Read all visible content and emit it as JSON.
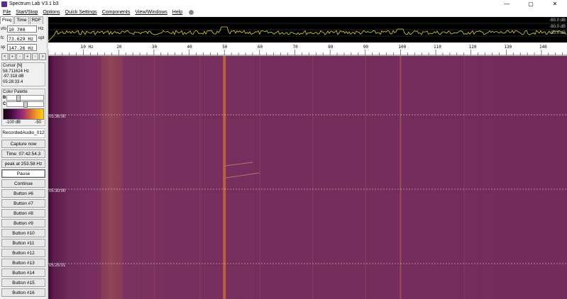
{
  "window": {
    "title": "Spectrum Lab V3.1 b3",
    "minimize": "—",
    "maximize": "▢",
    "close": "✕"
  },
  "menu": [
    "File",
    "Start/Stop",
    "Options",
    "Quick Settings",
    "Components",
    "View/Windows",
    "Help"
  ],
  "left_panel": {
    "tabs": [
      "Freq",
      "Time",
      "RDF"
    ],
    "fields": [
      {
        "label": "vfo",
        "value": "10 700 000",
        "unit": "Hz"
      },
      {
        "label": "fc",
        "value": "73.629 Hz",
        "unit": "opt"
      },
      {
        "label": "sp",
        "value": "147.26 Hz",
        "unit": ""
      }
    ],
    "small_buttons": [
      "<",
      "+",
      "-",
      "+",
      "-",
      ">"
    ],
    "cursor": {
      "title": "Cursor [N]",
      "freq": "58.711624 Hz",
      "level": "-97.318 dB",
      "time": "05:28:33.4"
    },
    "palette": {
      "title": "Color Palette",
      "b_label": "B",
      "c_label": "C",
      "min_label": "-100 dB",
      "max_label": "-50",
      "b_pos": 0.25,
      "c_pos": 0.45
    },
    "recorded_label": "RecordedAudio_012",
    "buttons": {
      "capture": "Capture now",
      "time": "Time:  07:42:54.3",
      "peak": "peak at 253.58 Hz",
      "pause": "Pause",
      "continue": "Continue",
      "extra": [
        "Button #6",
        "Button #7",
        "Button #8",
        "Button #9",
        "Button #10",
        "Button #11",
        "Button #12",
        "Button #13",
        "Button #14",
        "Button #15",
        "Button #16"
      ]
    }
  },
  "spectrum": {
    "db_labels": [
      "-60.0 dB",
      "-80.0 dB",
      "-90.0 dB"
    ]
  },
  "freq_scale": {
    "first_label": "10 Hz",
    "labels": [
      "20",
      "30",
      "40",
      "50",
      "60",
      "70",
      "80",
      "90",
      "100",
      "110",
      "120",
      "130",
      "140"
    ],
    "values": [
      10,
      20,
      30,
      40,
      50,
      60,
      70,
      80,
      90,
      100,
      110,
      120,
      130,
      140
    ],
    "min": 0,
    "max": 147.26
  },
  "waterfall": {
    "timestamps": [
      "05:36:00",
      "05:30:00",
      "05:25:01"
    ],
    "strong_lines_hz": [
      50,
      100
    ],
    "weak_lines_hz": [
      18,
      30,
      43,
      60,
      75,
      90,
      118
    ]
  },
  "colors": {
    "accent": "#f0a020",
    "waterfall_bg": "#742d5c",
    "spectrum_trace": "#d8d820"
  }
}
